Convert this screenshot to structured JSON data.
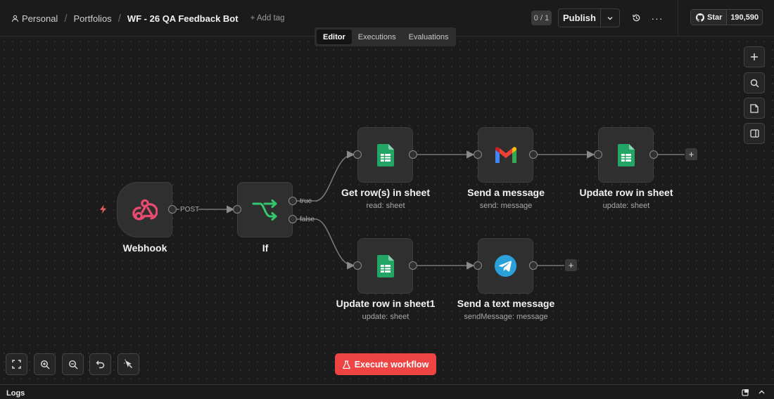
{
  "breadcrumb": {
    "personal": "Personal",
    "portfolios": "Portfolios",
    "workflow_name": "WF - 26 QA Feedback Bot",
    "add_tag": "+ Add tag"
  },
  "header": {
    "counter": "0 / 1",
    "publish_label": "Publish",
    "more_label": "···",
    "github_star_label": "Star",
    "github_star_count": "190,590"
  },
  "tabs": [
    {
      "label": "Editor",
      "active": true
    },
    {
      "label": "Executions",
      "active": false
    },
    {
      "label": "Evaluations",
      "active": false
    }
  ],
  "nodes": {
    "webhook": {
      "label": "Webhook",
      "icon": "webhook-icon",
      "color": "#ea4b71"
    },
    "if": {
      "label": "If",
      "icon": "branch-icon",
      "color": "#35c76e"
    },
    "get_rows": {
      "label": "Get row(s) in sheet",
      "sub": "read: sheet",
      "icon": "google-sheets-icon"
    },
    "send_message": {
      "label": "Send a message",
      "sub": "send: message",
      "icon": "gmail-icon"
    },
    "update_row": {
      "label": "Update row in sheet",
      "sub": "update: sheet",
      "icon": "google-sheets-icon"
    },
    "update_row1": {
      "label": "Update row in sheet1",
      "sub": "update: sheet",
      "icon": "google-sheets-icon"
    },
    "send_text": {
      "label": "Send a text message",
      "sub": "sendMessage: message",
      "icon": "telegram-icon"
    }
  },
  "edges": {
    "post": "POST",
    "true": "true",
    "false": "false"
  },
  "actions": {
    "execute_workflow": "Execute workflow"
  },
  "logs": {
    "label": "Logs"
  },
  "colors": {
    "accent_red": "#ef4444",
    "sheets_green": "#23a566",
    "telegram_blue": "#2aa1da",
    "canvas_bg": "#1b1b1b"
  }
}
